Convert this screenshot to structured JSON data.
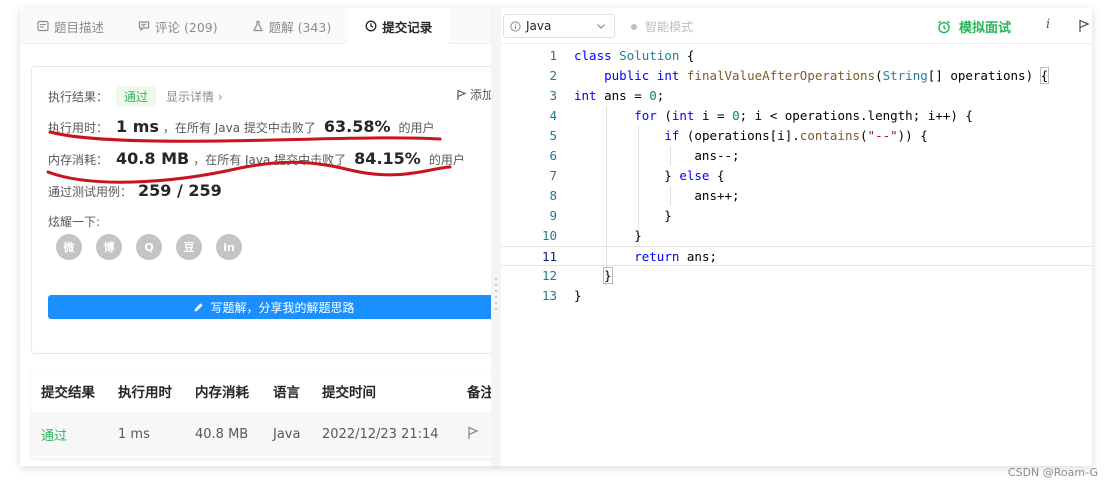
{
  "tabs": [
    {
      "label": "题目描述",
      "icon": "description-icon"
    },
    {
      "label": "评论 (209)",
      "icon": "comment-icon"
    },
    {
      "label": "题解 (343)",
      "icon": "flask-icon"
    },
    {
      "label": "提交记录",
      "icon": "clock-icon"
    }
  ],
  "result": {
    "label": "执行结果：",
    "status": "通过",
    "detail_link": "显示详情 ›",
    "add_note": "添加备",
    "runtime_label": "执行用时：",
    "runtime_value": "1 ms",
    "runtime_mid": "，在所有 Java 提交中击败了",
    "runtime_percent": "63.58%",
    "runtime_suffix": "的用户",
    "memory_label": "内存消耗：",
    "memory_value": "40.8 MB",
    "memory_mid": "，在所有 Java 提交中击败了",
    "memory_percent": "84.15%",
    "memory_suffix": "的用户",
    "tests_label": "通过测试用例：",
    "tests_value": "259 / 259",
    "share_label": "炫耀一下:",
    "write_button": "写题解，分享我的解题思路"
  },
  "share_icons": [
    "wechat-icon",
    "weibo-icon",
    "qq-icon",
    "douban-icon",
    "linkedin-icon"
  ],
  "share_glyphs": [
    "微",
    "博",
    "Q",
    "豆",
    "in"
  ],
  "submissions": {
    "headers": [
      "提交结果",
      "执行用时",
      "内存消耗",
      "语言",
      "提交时间",
      "备注"
    ],
    "rows": [
      {
        "status": "通过",
        "runtime": "1 ms",
        "memory": "40.8 MB",
        "language": "Java",
        "time": "2022/12/23 21:14"
      }
    ]
  },
  "editor": {
    "language": "Java",
    "smart_mode": "智能模式",
    "mock_interview": "模拟面试",
    "info_glyph": "i"
  },
  "code_lines": [
    {
      "n": "1",
      "html": "<span class=\"kw\">class</span> <span class=\"cls\">Solution</span> {"
    },
    {
      "n": "2",
      "html": "    <span class=\"kw\">public</span> <span class=\"kw\">int</span> <span class=\"fn\">finalValueAfterOperations</span>(<span class=\"ty\">String</span>[] operations) <span class=\"bracket\">{</span>"
    },
    {
      "n": "3",
      "html": "<span class=\"kw\">int</span> ans = <span class=\"num\">0</span>;"
    },
    {
      "n": "4",
      "html": "        <span class=\"kw\">for</span> (<span class=\"kw\">int</span> i = <span class=\"num\">0</span>; i &lt; operations.length; i++) {"
    },
    {
      "n": "5",
      "html": "            <span class=\"kw\">if</span> (operations[i].<span class=\"fn\">contains</span>(<span class=\"str\">\"--\"</span>)) {"
    },
    {
      "n": "6",
      "html": "                ans--;"
    },
    {
      "n": "7",
      "html": "            } <span class=\"kw\">else</span> {"
    },
    {
      "n": "8",
      "html": "                ans++;"
    },
    {
      "n": "9",
      "html": "            }"
    },
    {
      "n": "10",
      "html": "        }"
    },
    {
      "n": "11",
      "html": "        <span class=\"kw\">return</span> ans;"
    },
    {
      "n": "12",
      "html": "    <span class=\"bracket\">}</span>"
    },
    {
      "n": "13",
      "html": "}"
    }
  ],
  "current_line": 11,
  "watermark": "CSDN @Roam-G",
  "colors": {
    "accent_green": "#2db55d",
    "button_blue": "#1a90ff",
    "annotation_red": "#c8141e"
  }
}
